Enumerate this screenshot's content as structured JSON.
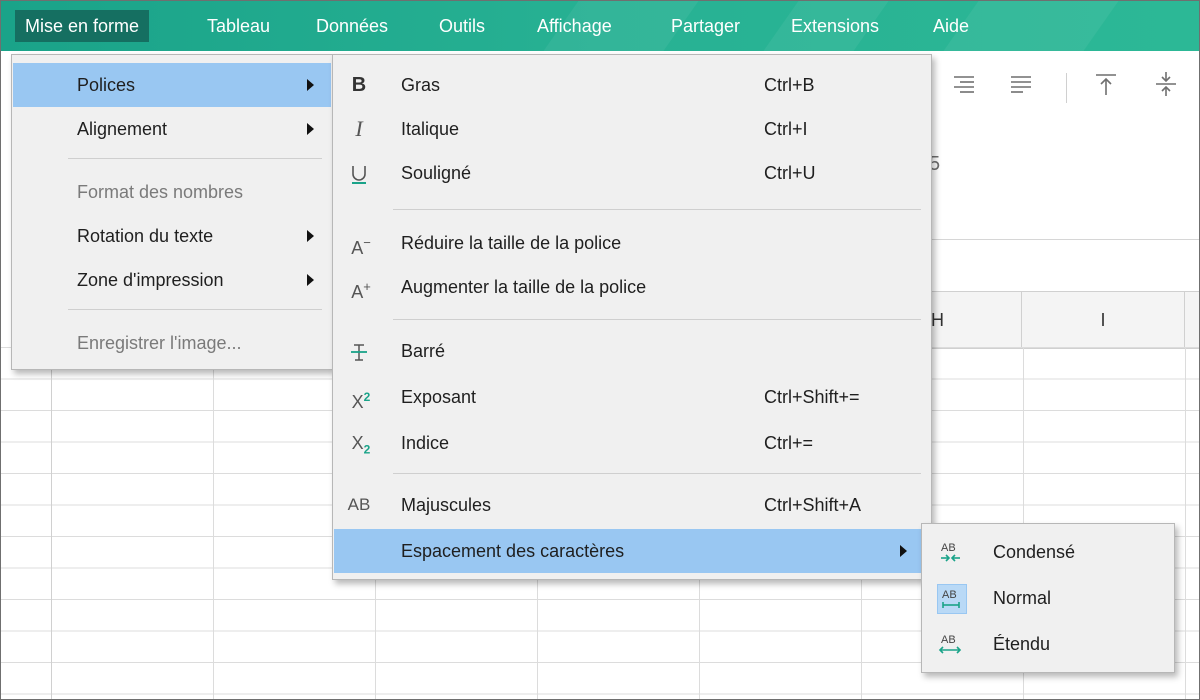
{
  "menubar": {
    "items": [
      "Mise en forme",
      "Tableau",
      "Données",
      "Outils",
      "Affichage",
      "Partager",
      "Extensions",
      "Aide"
    ]
  },
  "grid": {
    "col_h": "H",
    "col_i": "I"
  },
  "menu_format": {
    "items": [
      {
        "label": "Polices",
        "submenu": true,
        "highlighted": true
      },
      {
        "label": "Alignement",
        "submenu": true
      },
      {
        "label": "Format des nombres",
        "disabled": true
      },
      {
        "label": "Rotation du texte",
        "submenu": true
      },
      {
        "label": "Zone d'impression",
        "submenu": true
      },
      {
        "label": "Enregistrer l'image...",
        "disabled": true
      }
    ]
  },
  "menu_fonts": {
    "items": [
      {
        "icon": "B",
        "label": "Gras",
        "shortcut": "Ctrl+B"
      },
      {
        "icon": "I",
        "label": "Italique",
        "shortcut": "Ctrl+I"
      },
      {
        "icon": "U",
        "label": "Souligné",
        "shortcut": "Ctrl+U"
      },
      {
        "icon": "A⁻",
        "label": "Réduire la taille de la police",
        "shortcut": ""
      },
      {
        "icon": "A⁺",
        "label": "Augmenter la taille de la police",
        "shortcut": ""
      },
      {
        "icon": "T",
        "label": "Barré",
        "shortcut": ""
      },
      {
        "icon": "X²",
        "label": "Exposant",
        "shortcut": "Ctrl+Shift+="
      },
      {
        "icon": "X₂",
        "label": "Indice",
        "shortcut": "Ctrl+="
      },
      {
        "icon": "AB",
        "label": "Majuscules",
        "shortcut": "Ctrl+Shift+A"
      },
      {
        "icon": "",
        "label": "Espacement des caractères",
        "shortcut": "",
        "submenu": true,
        "highlighted": true
      }
    ]
  },
  "menu_spacing": {
    "items": [
      {
        "label": "Condensé",
        "selected": false
      },
      {
        "label": "Normal",
        "selected": true
      },
      {
        "label": "Étendu",
        "selected": false
      }
    ]
  },
  "colors": {
    "menubar": "#1ea58d",
    "highlight": "#99c7f2",
    "accent_teal": "#1aa389"
  }
}
